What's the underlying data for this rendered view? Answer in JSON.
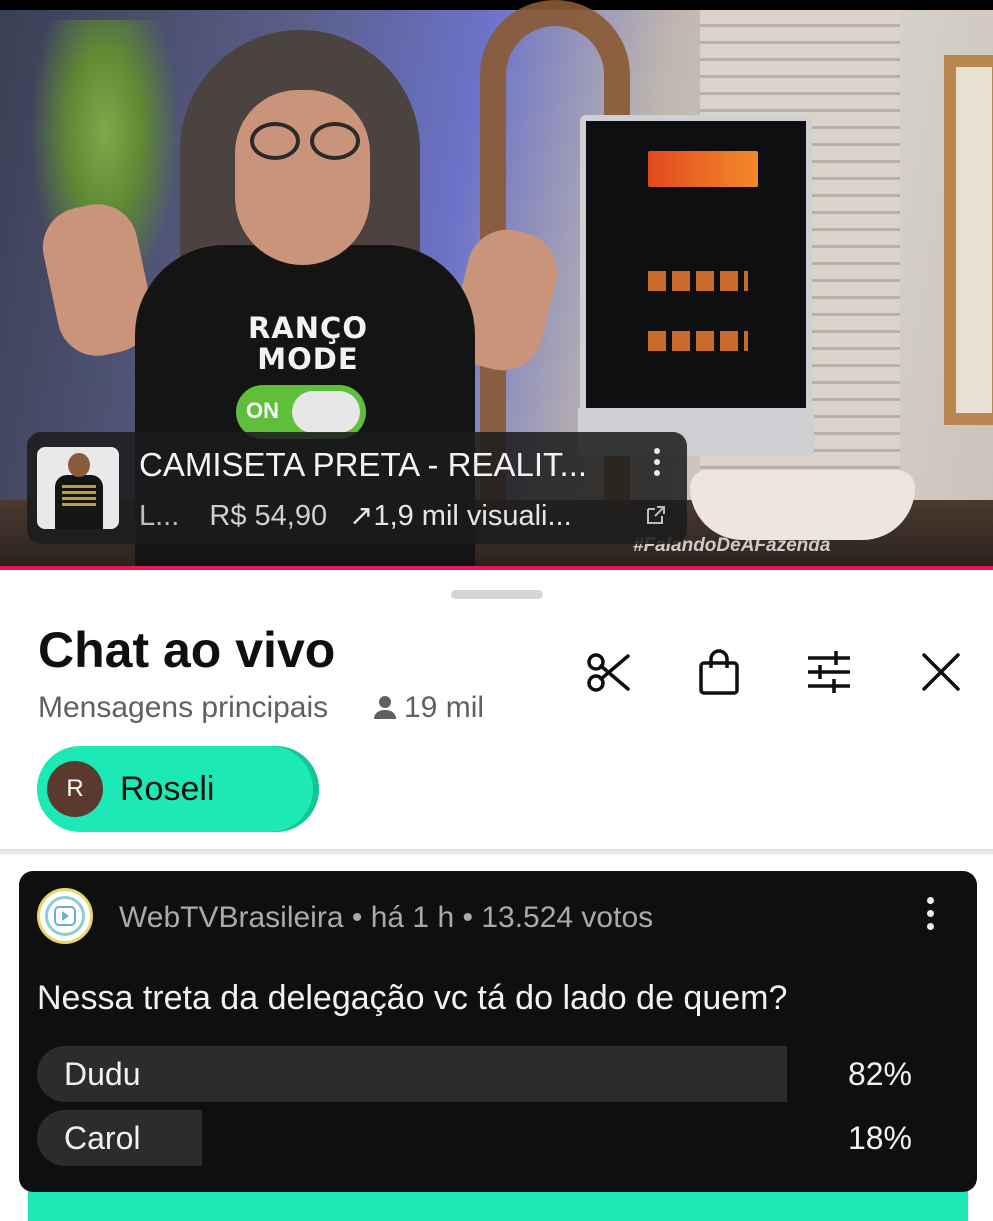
{
  "video": {
    "hashtag": "#FalandoDeAFazenda",
    "shirt_text": "RANÇO MODE",
    "shirt_toggle": "ON"
  },
  "product": {
    "title": "CAMISETA PRETA - REALIT...",
    "store": "L...",
    "price": "R$ 54,90",
    "views": "↗1,9 mil visuali...",
    "thumb_icon": "tshirt-model-thumbnail",
    "more_icon": "kebab-vertical-icon",
    "external_icon": "open-external-icon"
  },
  "chat": {
    "title": "Chat ao vivo",
    "mode": "Mensagens principais",
    "viewers": "19 mil",
    "icons": [
      "scissors-icon",
      "shopping-bag-icon",
      "sliders-icon",
      "close-icon"
    ],
    "pinned": {
      "avatar_letter": "R",
      "name": "Roseli"
    }
  },
  "poll": {
    "channel": "WebTVBrasileira",
    "time": "há 1 h",
    "votes": "13.524 votos",
    "question": "Nessa treta da delegação vc tá do lado de quem?",
    "options": [
      {
        "label": "Dudu",
        "percent": "82%",
        "fraction": 0.82
      },
      {
        "label": "Carol",
        "percent": "18%",
        "fraction": 0.18
      }
    ]
  },
  "colors": {
    "accent_chip": "#1de9b6",
    "progress_red": "#f0155b",
    "poll_bg": "#0f0f0f"
  }
}
